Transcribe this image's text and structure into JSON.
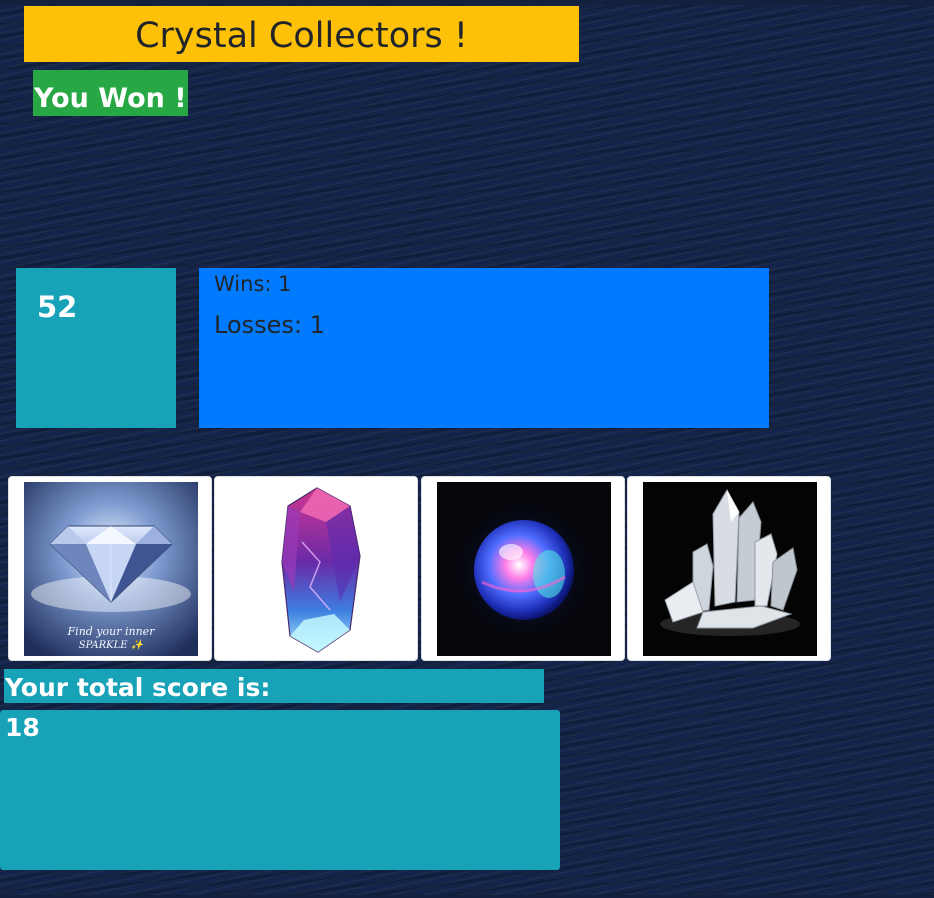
{
  "header": {
    "title": "Crystal Collectors !"
  },
  "status": {
    "message": "You Won !"
  },
  "target": {
    "value": "52"
  },
  "stats": {
    "wins_label": "Wins:",
    "wins": "1",
    "losses_label": "Losses:",
    "losses": "1"
  },
  "crystals": [
    {
      "name": "diamond",
      "caption_line1": "Find your inner",
      "caption_line2": "SPARKLE ✨"
    },
    {
      "name": "pink-blue-crystal"
    },
    {
      "name": "glowing-orb"
    },
    {
      "name": "quartz-cluster"
    }
  ],
  "score": {
    "label": "Your total score is:",
    "value": "18"
  },
  "colors": {
    "title_bg": "#ffc107",
    "win_badge_bg": "#28a745",
    "info_teal": "#17a2b8",
    "stats_blue": "#007bff",
    "page_bg": "#142448"
  }
}
